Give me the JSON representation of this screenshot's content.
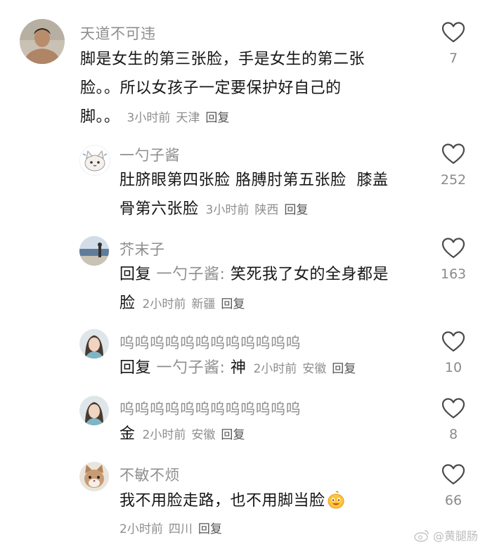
{
  "comments": [
    {
      "user": "天道不可违",
      "avatar": "man-photo-avatar",
      "text": "脚是女生的第三张脸，手是女生的第二张脸。。所以女孩子一定要保护好自己的脚。。",
      "lines": [
        "脚是女生的第三张脸，手是女生的第二张",
        "脸。。所以女孩子一定要保护好自己的",
        "脚。。"
      ],
      "time": "3小时前",
      "location": "天津",
      "reply_label": "回复",
      "likes": "7"
    },
    {
      "user": "一勺子酱",
      "avatar": "cartoon-cat-avatar",
      "lines": [
        "肚脐眼第四张脸 胳膊肘第五张脸  膝盖",
        "骨第六张脸"
      ],
      "time": "3小时前",
      "location": "陕西",
      "reply_label": "回复",
      "likes": "252"
    },
    {
      "user": "芥末子",
      "avatar": "seaside-photo-avatar",
      "reply_prefix": "回复",
      "mention": "一勺子酱:",
      "lines": [
        " 笑死我了女的全身都是",
        "脸"
      ],
      "time": "2小时前",
      "location": "新疆",
      "reply_label": "回复",
      "likes": "163"
    },
    {
      "user": "呜呜呜呜呜呜呜呜呜呜呜呜",
      "avatar": "girl-photo-avatar",
      "reply_prefix": "回复",
      "mention": "一勺子酱:",
      "text": " 神",
      "time": "2小时前",
      "location": "安徽",
      "reply_label": "回复",
      "likes": "10"
    },
    {
      "user": "呜呜呜呜呜呜呜呜呜呜呜呜",
      "avatar": "girl-photo-avatar",
      "text": "金",
      "time": "2小时前",
      "location": "安徽",
      "reply_label": "回复",
      "likes": "8"
    },
    {
      "user": "不敏不烦",
      "avatar": "cat-photo-avatar",
      "text": "我不用脸走路，也不用脚当脸",
      "emoji": "smiling-face-emoji",
      "time": "2小时前",
      "location": "四川",
      "reply_label": "回复",
      "likes": "66"
    }
  ],
  "watermark": "@黄腿肠",
  "colors": {
    "username": "#8e8e8e",
    "text": "#161616",
    "count": "#8a8a8a"
  }
}
